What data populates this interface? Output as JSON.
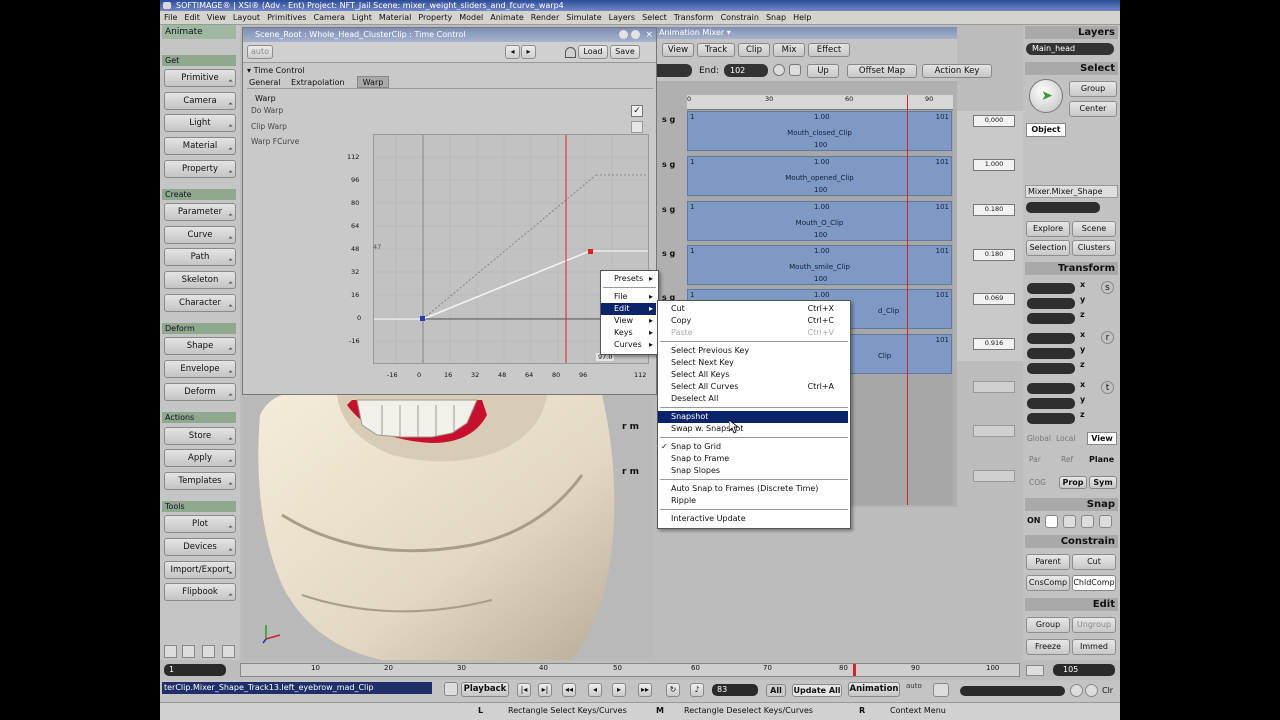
{
  "title": "SOFTIMAGE® | XSI® (Adv - Ent) Project: NFT_Jail    Scene: mixer_weight_sliders_and_fcurve_warp4",
  "menubar": [
    "File",
    "Edit",
    "View",
    "Layout",
    "Primitives",
    "Camera",
    "Light",
    "Material",
    "Property",
    "Model",
    "Animate",
    "Render",
    "Simulate",
    "Layers",
    "Select",
    "Transform",
    "Constrain",
    "Snap",
    "Help"
  ],
  "left_toolbar": {
    "mode": "Animate",
    "sections": {
      "get": "Get",
      "create": "Create",
      "deform": "Deform",
      "actions": "Actions",
      "tools": "Tools"
    },
    "get_buttons": [
      "Primitive",
      "Camera",
      "Light",
      "Material",
      "Property"
    ],
    "create_buttons": [
      "Parameter",
      "Curve",
      "Path",
      "Skeleton",
      "Character"
    ],
    "deform_buttons": [
      "Shape",
      "Envelope",
      "Deform"
    ],
    "action_buttons": [
      "Store",
      "Apply",
      "Templates"
    ],
    "tool_buttons": [
      "Plot",
      "Devices",
      "Import/Export",
      "Flipbook"
    ]
  },
  "fcurve": {
    "title": "Scene_Root : Whole_Head_ClusterClip : Time Control",
    "auto": "auto",
    "load": "Load",
    "save": "Save",
    "section": "Time Control",
    "tabs": [
      "General",
      "Extrapolation",
      "Warp"
    ],
    "warp_label": "Warp",
    "do_warp": "Do Warp",
    "clip_warp": "Clip Warp",
    "warp_fcurve": "Warp FCurve",
    "y_ticks": [
      "112",
      "96",
      "80",
      "64",
      "48",
      "32",
      "16",
      "0",
      "-16"
    ],
    "x_ticks": [
      "-16",
      "0",
      "16",
      "32",
      "48",
      "64",
      "80",
      "96",
      "112"
    ],
    "y_marker": "47",
    "end_label": "97.0"
  },
  "graph_menu": {
    "items": [
      "Presets",
      "File",
      "Edit",
      "View",
      "Keys",
      "Curves"
    ],
    "highlighted": "Edit"
  },
  "edit_menu": {
    "group1": [
      {
        "label": "Cut",
        "shortcut": "Ctrl+X"
      },
      {
        "label": "Copy",
        "shortcut": "Ctrl+C"
      },
      {
        "label": "Paste",
        "shortcut": "Ctrl+V"
      }
    ],
    "group2": [
      {
        "label": "Select Previous Key",
        "shortcut": ""
      },
      {
        "label": "Select Next Key",
        "shortcut": ""
      },
      {
        "label": "Select All Keys",
        "shortcut": ""
      },
      {
        "label": "Select All Curves",
        "shortcut": "Ctrl+A"
      },
      {
        "label": "Deselect All",
        "shortcut": ""
      }
    ],
    "group3": [
      {
        "label": "Snapshot",
        "shortcut": ""
      },
      {
        "label": "Swap w. Snapshot",
        "shortcut": ""
      }
    ],
    "group4": [
      {
        "label": "Snap to Grid",
        "shortcut": "",
        "checked": "✓"
      },
      {
        "label": "Snap to Frame",
        "shortcut": ""
      },
      {
        "label": "Snap Slopes",
        "shortcut": ""
      }
    ],
    "group5": [
      {
        "label": "Auto Snap to Frames (Discrete Time)",
        "shortcut": ""
      },
      {
        "label": "Ripple",
        "shortcut": ""
      }
    ],
    "group6": [
      {
        "label": "Interactive Update",
        "shortcut": ""
      }
    ]
  },
  "mixer": {
    "title": "Animation Mixer",
    "menu": [
      "View",
      "Track",
      "Clip",
      "Mix",
      "Effect"
    ],
    "end_label": "End:",
    "end_value": "102",
    "up": "Up",
    "offset_map": "Offset Map",
    "action_key": "Action Key",
    "ruler": [
      "0",
      "30",
      "60",
      "90"
    ],
    "clips": [
      {
        "name": "Mouth_closed_Clip",
        "weight": "0.000"
      },
      {
        "name": "Mouth_opened_Clip",
        "weight": "1.000"
      },
      {
        "name": "Mouth_O_Clip",
        "weight": "0.180"
      },
      {
        "name": "Mouth_smile_Clip",
        "weight": "0.180"
      },
      {
        "name": "d_Clip",
        "weight": "0.069"
      },
      {
        "name": "Clip",
        "weight": "0.916"
      }
    ],
    "clip_start": "1",
    "clip_mid": "1.00",
    "clip_end": "100",
    "clip_right": "101",
    "sg": "s g",
    "rm": "r m"
  },
  "right_panel": {
    "layers_head": "Layers",
    "layer_value": "Main_head",
    "select_head": "Select",
    "group": "Group",
    "center": "Center",
    "object": "Object",
    "selection_name": "Mixer.Mixer_Shape",
    "explore": "Explore",
    "scene": "Scene",
    "selection": "Selection",
    "clusters": "Clusters",
    "transform_head": "Transform",
    "axes": [
      "x",
      "y",
      "z"
    ],
    "transform_letters": [
      "s",
      "r",
      "t"
    ],
    "global": "Global",
    "local": "Local",
    "view": "View",
    "par": "Par",
    "ref": "Ref",
    "plane": "Plane",
    "cog": "COG",
    "prop": "Prop",
    "sym": "Sym",
    "snap_head": "Snap",
    "on": "ON",
    "constrain_head": "Constrain",
    "parent": "Parent",
    "cut": "Cut",
    "cnscomp": "CnsComp",
    "chldcomp": "ChldComp",
    "edit_head": "Edit",
    "group2": "Group",
    "ungroup": "Ungroup",
    "freeze": "Freeze",
    "immed": "Immed"
  },
  "timeline": {
    "start": "1",
    "ticks": [
      "10",
      "20",
      "30",
      "40",
      "50",
      "60",
      "70",
      "80",
      "90",
      "100"
    ],
    "end": "105"
  },
  "bottom": {
    "track_path": "terClip.Mixer_Shape_Track13.left_eyebrow_mad_Clip",
    "playback": "Playback",
    "frame": "83",
    "all": "All",
    "update_all": "Update All",
    "animation": "Animation",
    "auto": "auto",
    "clr": "Clr"
  },
  "status": {
    "l": "L",
    "left": "Rectangle Select Keys/Curves",
    "m": "M",
    "mid": "Rectangle Deselect Keys/Curves",
    "r": "R",
    "right": "Context Menu"
  },
  "colors": {
    "accent_title": "#2d4c98",
    "clip_blue": "#7e9ac4",
    "menu_highlight": "#0a246a",
    "current_frame": "#e02020",
    "lips": "#c8102e"
  }
}
